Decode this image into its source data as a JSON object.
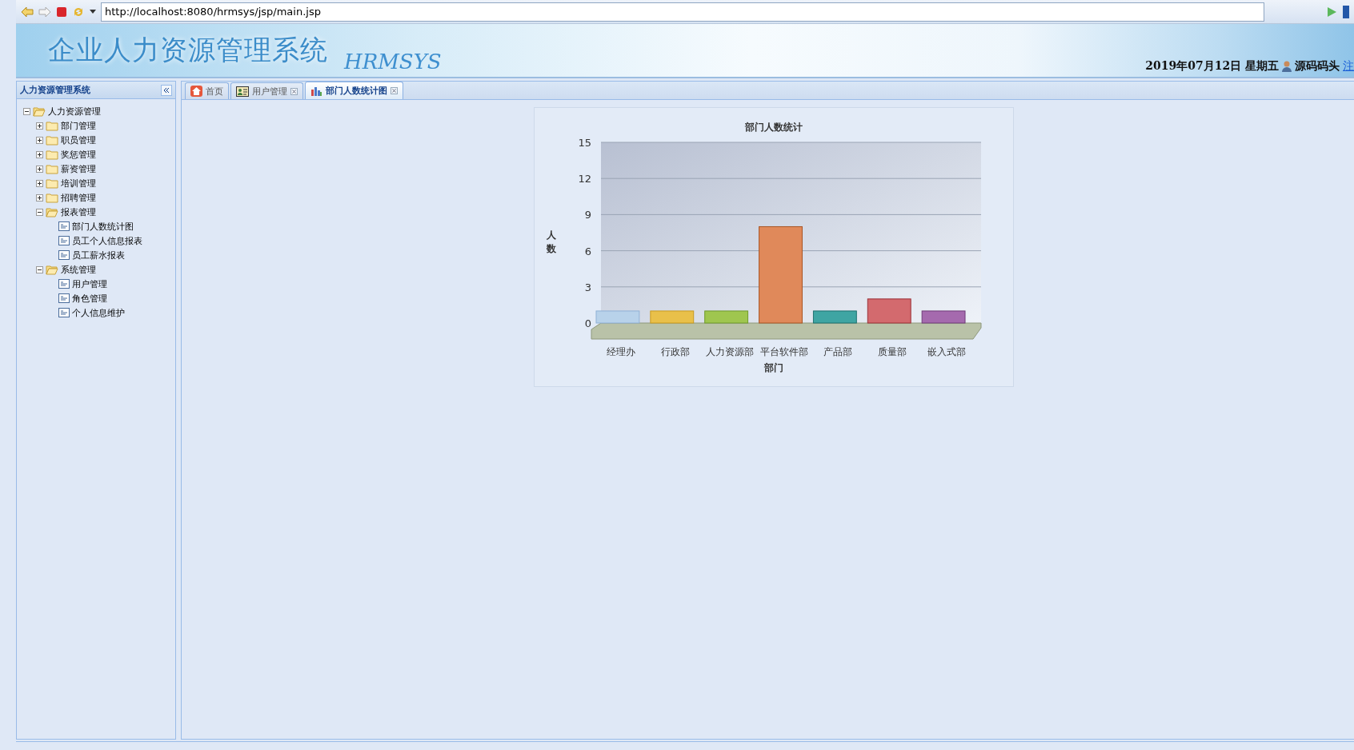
{
  "browser": {
    "url": "http://localhost:8080/hrmsys/jsp/main.jsp"
  },
  "header": {
    "title": "企业人力资源管理系统",
    "logo": "HRMSYS",
    "date": "2019年07月12日 星期五",
    "user": "源码码头",
    "logout": "注"
  },
  "sidebar": {
    "title": "人力资源管理系统",
    "tree": [
      {
        "label": "人力资源管理",
        "kind": "folder",
        "expanded": true,
        "children": [
          {
            "label": "部门管理",
            "kind": "folder",
            "expanded": false
          },
          {
            "label": "职员管理",
            "kind": "folder",
            "expanded": false
          },
          {
            "label": "奖惩管理",
            "kind": "folder",
            "expanded": false
          },
          {
            "label": "薪资管理",
            "kind": "folder",
            "expanded": false
          },
          {
            "label": "培训管理",
            "kind": "folder",
            "expanded": false
          },
          {
            "label": "招聘管理",
            "kind": "folder",
            "expanded": false
          },
          {
            "label": "报表管理",
            "kind": "folder",
            "expanded": true,
            "children": [
              {
                "label": "部门人数统计图",
                "kind": "leaf"
              },
              {
                "label": "员工个人信息报表",
                "kind": "leaf"
              },
              {
                "label": "员工薪水报表",
                "kind": "leaf"
              }
            ]
          },
          {
            "label": "系统管理",
            "kind": "folder",
            "expanded": true,
            "children": [
              {
                "label": "用户管理",
                "kind": "leaf"
              },
              {
                "label": "角色管理",
                "kind": "leaf"
              },
              {
                "label": "个人信息维护",
                "kind": "leaf"
              }
            ]
          }
        ]
      }
    ]
  },
  "tabs": [
    {
      "label": "首页",
      "selected": false,
      "closable": false
    },
    {
      "label": "用户管理",
      "selected": false,
      "closable": true
    },
    {
      "label": "部门人数统计图",
      "selected": true,
      "closable": true
    }
  ],
  "chart_data": {
    "type": "bar",
    "title": "部门人数统计",
    "xlabel": "部门",
    "ylabel": "人数",
    "categories": [
      "经理办",
      "行政部",
      "人力资源部",
      "平台软件部",
      "产品部",
      "质量部",
      "嵌入式部"
    ],
    "values": [
      1,
      1,
      1,
      8,
      1,
      2,
      1
    ],
    "grid": true,
    "ylim": [
      0,
      15
    ],
    "yticks": [
      0,
      3,
      6,
      9,
      12,
      15
    ]
  }
}
